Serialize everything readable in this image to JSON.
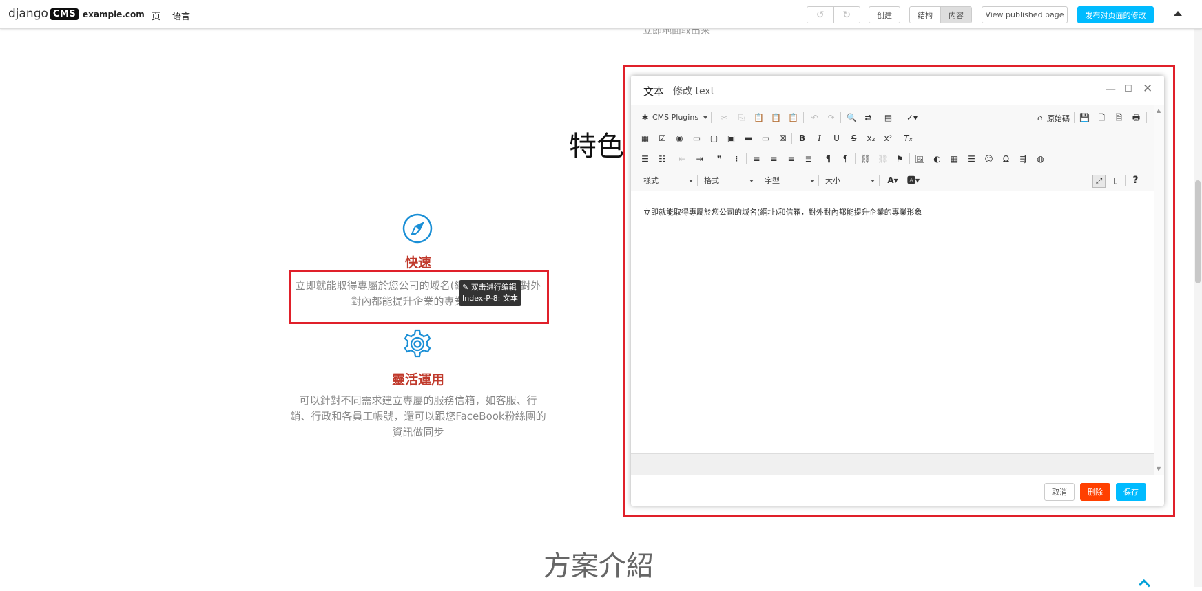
{
  "toolbar": {
    "logo_text": "django",
    "logo_badge": "CMS",
    "site": "example.com",
    "page_menu": "页",
    "language_menu": "语言",
    "undo_icon": "undo-icon",
    "redo_icon": "redo-icon",
    "create_label": "创建",
    "structure_label": "结构",
    "content_label": "内容",
    "view_published_label": "View published page",
    "publish_label": "发布对页面的修改",
    "accent_color": "#00bbff"
  },
  "page": {
    "faded_top_text": "立即地面取出来",
    "section_title": "特色",
    "features": [
      {
        "icon": "compass-icon",
        "title": "快速",
        "text_line1": "立即就能取得專屬於您公司的域名(網址)和信箱，對外",
        "text_line2": "對內都能提升企業的專業形象"
      },
      {
        "icon": "gear-icon",
        "title": "靈活運用",
        "text_line1": "可以針對不同需求建立專屬的服務信箱，如客服、行",
        "text_line2": "銷、行政和各員工帳號，還可以跟您FaceBook粉絲團的",
        "text_line3": "資訊做同步"
      }
    ],
    "tooltip": {
      "line1": "✎ 双击进行编辑",
      "line2": "Index-P-8: 文本"
    },
    "bottom_title": "方案介紹",
    "highlight_color": "#e0202a"
  },
  "modal": {
    "title": "文本",
    "breadcrumb": "修改 text",
    "toolbar": {
      "cms_plugins": "CMS Plugins",
      "source_label": "原始碼",
      "styles_label": "樣式",
      "format_label": "格式",
      "font_label": "字型",
      "size_label": "大小"
    },
    "editor_text": "立即就能取得專屬於您公司的域名(網址)和信箱，對外對內都能提升企業的專業形象",
    "buttons": {
      "cancel": "取消",
      "delete": "删除",
      "save": "保存"
    },
    "delete_color": "#ff4000",
    "save_color": "#00bbff"
  }
}
